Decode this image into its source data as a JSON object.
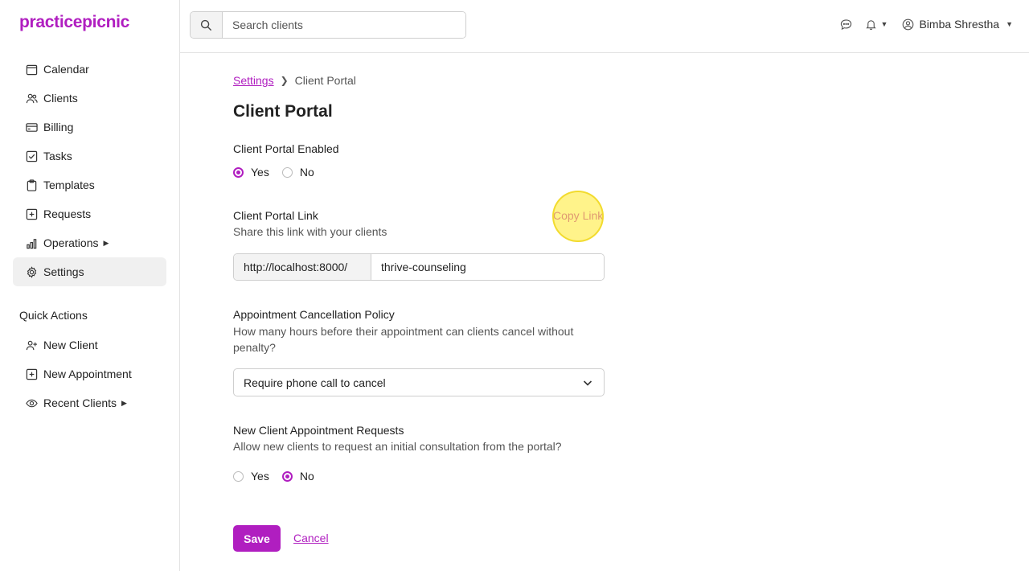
{
  "app": {
    "logo": "practicepicnic"
  },
  "sidebar": {
    "items": [
      {
        "label": "Calendar",
        "icon": "calendar-icon"
      },
      {
        "label": "Clients",
        "icon": "users-icon"
      },
      {
        "label": "Billing",
        "icon": "credit-card-icon"
      },
      {
        "label": "Tasks",
        "icon": "checkbox-icon"
      },
      {
        "label": "Templates",
        "icon": "clipboard-icon"
      },
      {
        "label": "Requests",
        "icon": "plus-square-icon"
      },
      {
        "label": "Operations",
        "icon": "bar-chart-icon"
      },
      {
        "label": "Settings",
        "icon": "gear-icon",
        "active": true
      }
    ],
    "quick_actions_title": "Quick Actions",
    "quick_actions": [
      {
        "label": "New Client",
        "icon": "user-plus-icon"
      },
      {
        "label": "New Appointment",
        "icon": "plus-square-icon"
      },
      {
        "label": "Recent Clients",
        "icon": "eye-icon"
      }
    ]
  },
  "header": {
    "search_placeholder": "Search clients",
    "user_name": "Bimba Shrestha"
  },
  "breadcrumb": {
    "parent": "Settings",
    "current": "Client Portal"
  },
  "page_title": "Client Portal",
  "portal_enabled": {
    "label": "Client Portal Enabled",
    "yes": "Yes",
    "no": "No",
    "selected": "Yes"
  },
  "portal_link": {
    "label": "Client Portal Link",
    "help": "Share this link with your clients",
    "copy_label": "Copy Link",
    "prefix": "http://localhost:8000/",
    "value": "thrive-counseling"
  },
  "cancellation": {
    "label": "Appointment Cancellation Policy",
    "help": "How many hours before their appointment can clients cancel without penalty?",
    "selected": "Require phone call to cancel"
  },
  "new_client_requests": {
    "label": "New Client Appointment Requests",
    "help": "Allow new clients to request an initial consultation from the portal?",
    "yes": "Yes",
    "no": "No",
    "selected": "No"
  },
  "actions": {
    "save": "Save",
    "cancel": "Cancel"
  },
  "colors": {
    "accent": "#b01ec0",
    "active_bg": "#f0f0f0"
  }
}
